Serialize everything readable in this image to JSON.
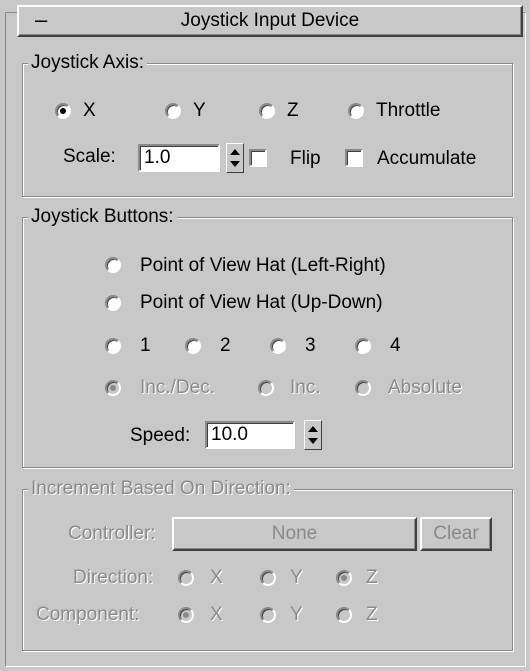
{
  "rollout": {
    "collapse_glyph": "–",
    "title": "Joystick Input Device"
  },
  "axis_group": {
    "legend": "Joystick Axis:",
    "options": [
      {
        "label": "X",
        "checked": true
      },
      {
        "label": "Y",
        "checked": false
      },
      {
        "label": "Z",
        "checked": false
      },
      {
        "label": "Throttle",
        "checked": false
      }
    ],
    "scale_label": "Scale:",
    "scale_value": "1.0",
    "flip_label": "Flip",
    "accumulate_label": "Accumulate"
  },
  "buttons_group": {
    "legend": "Joystick Buttons:",
    "pov_left_right": "Point of View Hat (Left-Right)",
    "pov_up_down": "Point of View Hat (Up-Down)",
    "numbers": [
      "1",
      "2",
      "3",
      "4"
    ],
    "modes": [
      "Inc./Dec.",
      "Inc.",
      "Absolute"
    ],
    "speed_label": "Speed:",
    "speed_value": "10.0"
  },
  "increment_group": {
    "legend": "Increment Based On Direction:",
    "controller_label": "Controller:",
    "controller_value": "None",
    "clear_label": "Clear",
    "direction_label": "Direction:",
    "direction_options": [
      "X",
      "Y",
      "Z"
    ],
    "component_label": "Component:",
    "component_options": [
      "X",
      "Y",
      "Z"
    ]
  }
}
